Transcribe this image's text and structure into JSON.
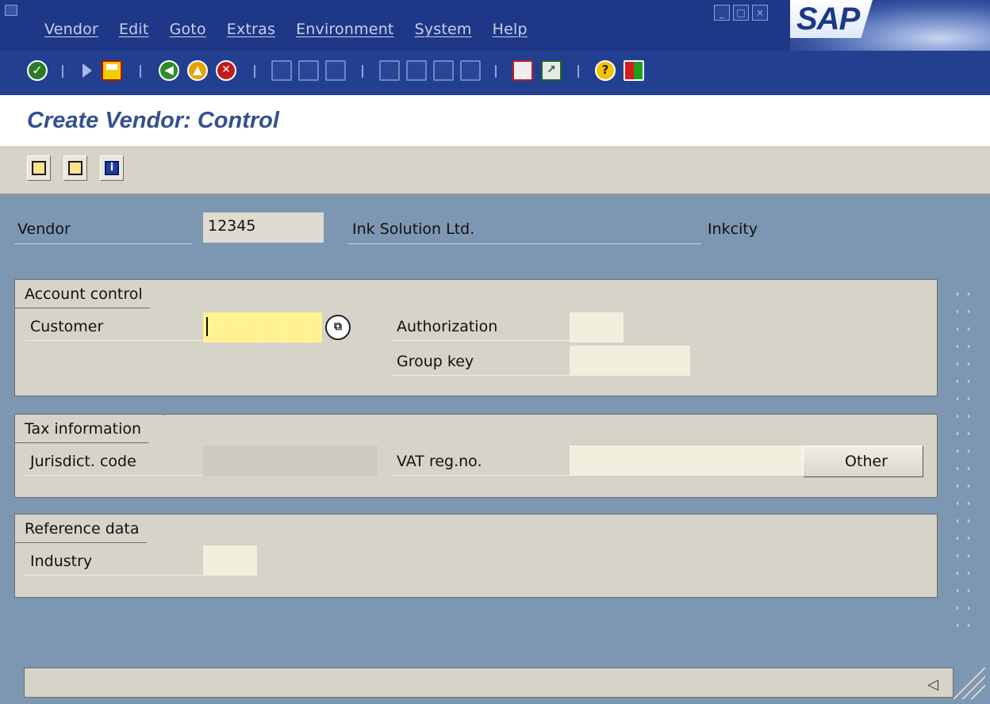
{
  "menubar": {
    "items": [
      "Vendor",
      "Edit",
      "Goto",
      "Extras",
      "Environment",
      "System",
      "Help"
    ],
    "logo": "SAP",
    "icons": [
      "window-icon",
      "minimize-icon",
      "maximize-icon",
      "close-icon"
    ]
  },
  "toolbar": {
    "icons": [
      "enter-icon",
      "command-field-icon",
      "save-icon",
      "back-icon",
      "exit-icon",
      "cancel-icon",
      "print-icon",
      "find-icon",
      "find-next-icon",
      "first-page-icon",
      "previous-page-icon",
      "next-page-icon",
      "last-page-icon",
      "create-session-icon",
      "create-shortcut-icon",
      "help-icon",
      "layout-menu-icon"
    ]
  },
  "title": "Create Vendor: Control",
  "app_toolbar": {
    "icons": [
      "previous-screen-icon",
      "next-screen-icon",
      "administrative-data-icon"
    ]
  },
  "header": {
    "vendor_label": "Vendor",
    "vendor_number": "12345",
    "vendor_name": "Ink Solution Ltd.",
    "vendor_city": "Inkcity"
  },
  "groups": {
    "account_control": {
      "title": "Account control",
      "customer_label": "Customer",
      "customer_value": "",
      "authorization_label": "Authorization",
      "authorization_value": "",
      "group_key_label": "Group key",
      "group_key_value": ""
    },
    "tax_information": {
      "title": "Tax information",
      "jurisdiction_label": "Jurisdict. code",
      "jurisdiction_value": "",
      "vat_label": "VAT reg.no.",
      "vat_value": "",
      "other_button": "Other"
    },
    "reference_data": {
      "title": "Reference data",
      "industry_label": "Industry",
      "industry_value": ""
    }
  },
  "colors": {
    "menubar_bg": "#1e3887",
    "title_text": "#34508f",
    "work_area_bg": "#7d97b3",
    "group_bg": "#d6d3c8",
    "focus_field": "#fff07a"
  }
}
